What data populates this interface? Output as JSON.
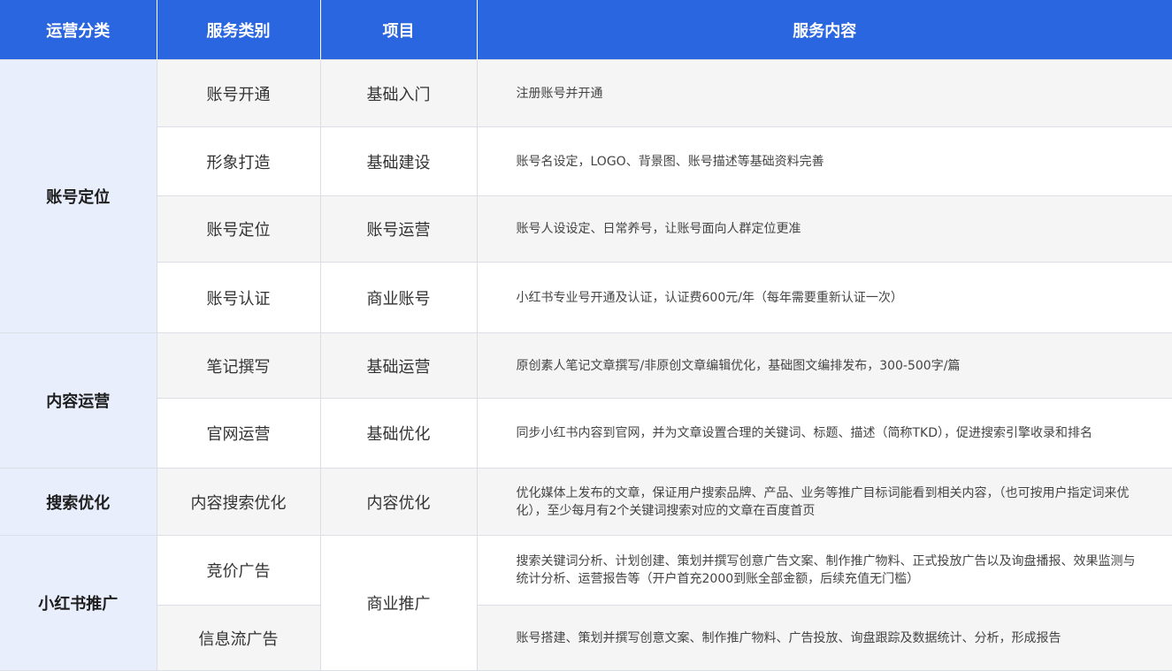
{
  "headers": [
    "运营分类",
    "服务类别",
    "项目",
    "服务内容"
  ],
  "rows": [
    {
      "category": "账号定位",
      "service": "账号开通",
      "item": "基础入门",
      "content": "注册账号并开通"
    },
    {
      "service": "形象打造",
      "item": "基础建设",
      "content": "账号名设定，LOGO、背景图、账号描述等基础资料完善"
    },
    {
      "service": "账号定位",
      "item": "账号运营",
      "content": "账号人设设定、日常养号，让账号面向人群定位更准"
    },
    {
      "service": "账号认证",
      "item": "商业账号",
      "content": "小红书专业号开通及认证，认证费600元/年（每年需要重新认证一次）"
    },
    {
      "category": "内容运营",
      "service": "笔记撰写",
      "item": "基础运营",
      "content": "原创素人笔记文章撰写/非原创文章编辑优化，基础图文编排发布，300-500字/篇"
    },
    {
      "service": "官网运营",
      "item": "基础优化",
      "content": "同步小红书内容到官网，并为文章设置合理的关键词、标题、描述（简称TKD），促进搜索引擎收录和排名"
    },
    {
      "category": "搜索优化",
      "service": "内容搜索优化",
      "item": "内容优化",
      "content": "优化媒体上发布的文章，保证用户搜索品牌、产品、业务等推广目标词能看到相关内容，（也可按用户指定词来优化），至少每月有2个关键词搜索对应的文章在百度首页"
    },
    {
      "category": "小红书推广",
      "service": "竞价广告",
      "item": "商业推广",
      "content": "搜索关键词分析、计划创建、策划并撰写创意广告文案、制作推广物料、正式投放广告以及询盘播报、效果监测与统计分析、运营报告等（开户首充2000到账全部金额，后续充值无门槛）"
    },
    {
      "service": "信息流广告",
      "content": "账号搭建、策划并撰写创意文案、制作推广物料、广告投放、询盘跟踪及数据统计、分析，形成报告"
    }
  ]
}
